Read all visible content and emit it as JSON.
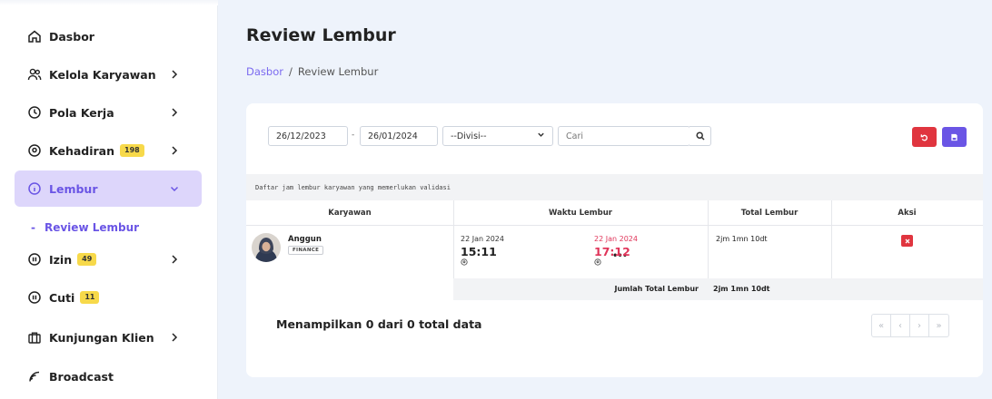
{
  "sidebar": {
    "items": [
      {
        "label": "Dasbor",
        "icon": "home-icon"
      },
      {
        "label": "Kelola Karyawan",
        "icon": "users-icon",
        "has_chevron": true
      },
      {
        "label": "Pola Kerja",
        "icon": "clock-icon",
        "has_chevron": true
      },
      {
        "label": "Kehadiran",
        "icon": "location-pin-icon",
        "badge": "198",
        "has_chevron": true
      },
      {
        "label": "Lembur",
        "icon": "info-icon",
        "active": true,
        "expanded": true
      },
      {
        "label": "Izin",
        "icon": "pause-circle-icon",
        "badge": "49",
        "has_chevron": true
      },
      {
        "label": "Cuti",
        "icon": "pause-circle-icon",
        "badge": "11"
      },
      {
        "label": "Kunjungan Klien",
        "icon": "briefcase-icon",
        "has_chevron": true
      },
      {
        "label": "Broadcast",
        "icon": "broadcast-icon"
      }
    ],
    "sub_item": {
      "label": "Review Lembur",
      "prefix": "-"
    }
  },
  "page": {
    "title": "Review Lembur",
    "breadcrumb": {
      "home": "Dasbor",
      "separator": "/",
      "current": "Review Lembur"
    }
  },
  "filters": {
    "date_from": "26/12/2023",
    "date_separator": "-",
    "date_to": "26/01/2024",
    "division": "--Divisi--",
    "search_placeholder": "Cari"
  },
  "table": {
    "description": "Daftar jam lembur karyawan yang memerlukan validasi",
    "headers": {
      "employee": "Karyawan",
      "time": "Waktu Lembur",
      "total": "Total Lembur",
      "action": "Aksi"
    },
    "rows": [
      {
        "name": "Anggun",
        "division": "FINANCE",
        "start_date": "22 Jan 2024",
        "start_time": "15:11",
        "end_date": "22 Jan 2024",
        "end_time": "17:12",
        "total": "2jm 1mn 10dt"
      }
    ],
    "summary_label": "Jumlah Total Lembur",
    "summary_value": "2jm 1mn 10dt"
  },
  "pagination": {
    "info": "Menampilkan 0 dari 0 total data",
    "first": "«",
    "prev": "‹",
    "next": "›",
    "last": "»"
  },
  "colors": {
    "accent": "#6a55e5",
    "danger": "#e0353f",
    "badge": "#f7d94a",
    "end_time": "#e0355a"
  }
}
